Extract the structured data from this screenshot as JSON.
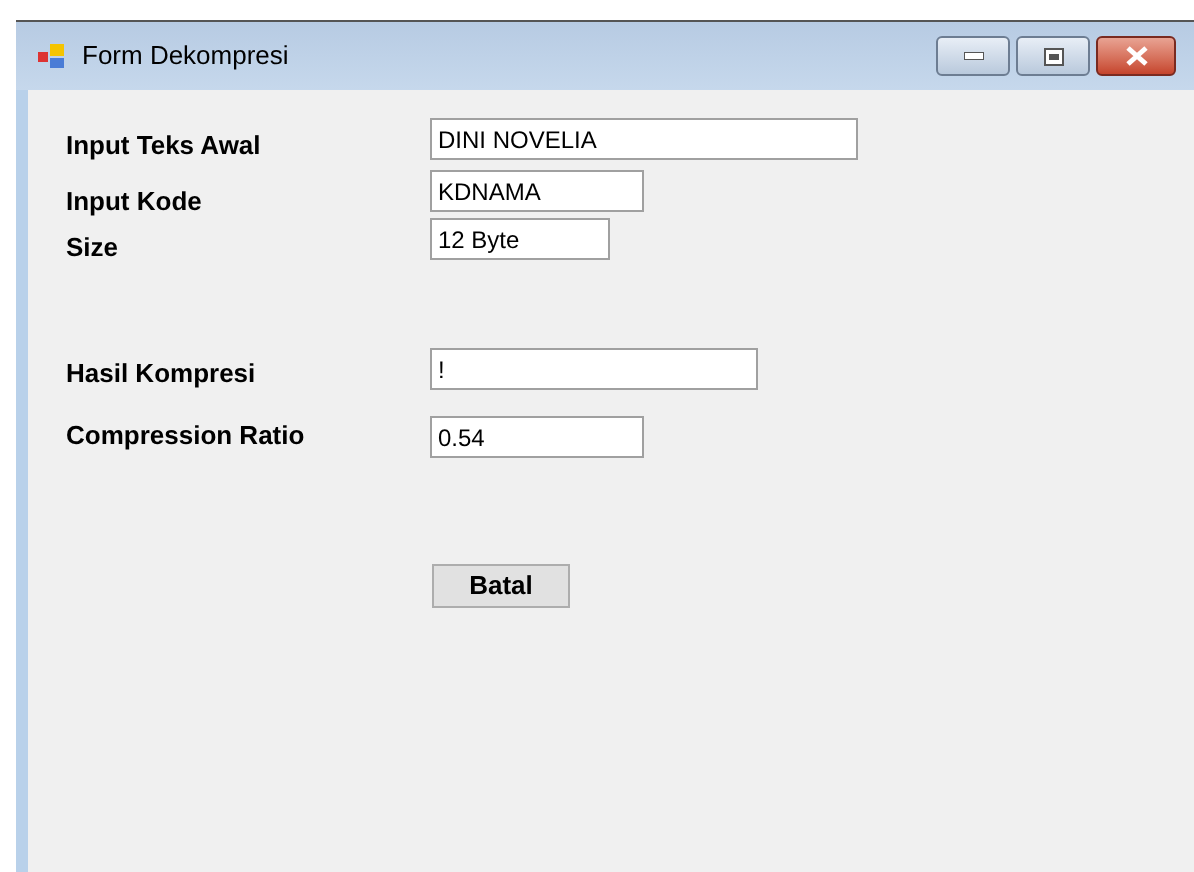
{
  "window": {
    "title": "Form Dekompresi"
  },
  "fields_top": [
    {
      "label": "Input Teks Awal",
      "value": "DINI NOVELIA"
    },
    {
      "label": "Input Kode",
      "value": "KDNAMA"
    },
    {
      "label": "Size",
      "value": "12 Byte"
    }
  ],
  "fields_bottom": [
    {
      "label": "Hasil Kompresi",
      "value": "!"
    },
    {
      "label": "Compression Ratio",
      "value": "0.54"
    }
  ],
  "buttons": [
    "Batal"
  ]
}
